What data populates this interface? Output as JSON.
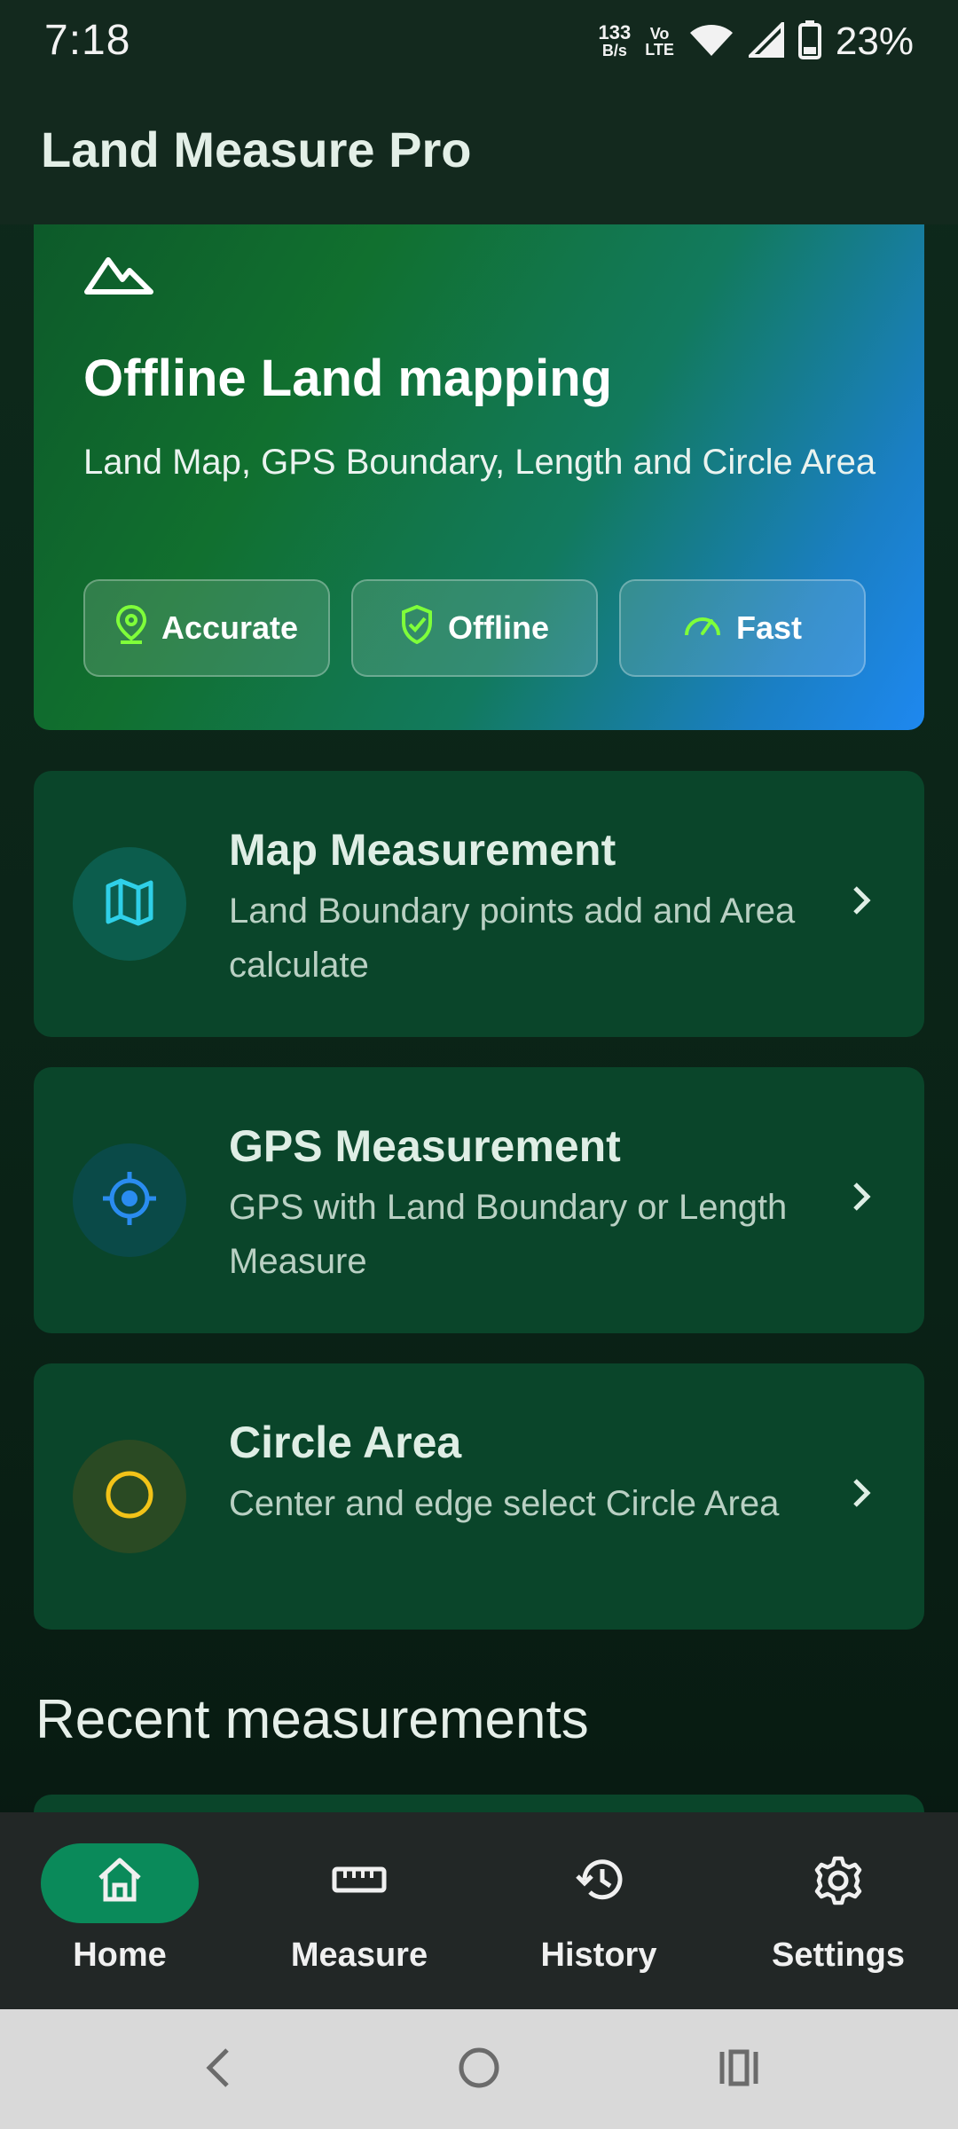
{
  "status_bar": {
    "time": "7:18",
    "net_speed_value": "133",
    "net_speed_unit": "B/s",
    "volte_top": "Vo",
    "volte_bottom": "LTE",
    "battery": "23%"
  },
  "app_bar": {
    "title": "Land Measure Pro"
  },
  "hero": {
    "title": "Offline Land mapping",
    "subtitle": "Land Map, GPS Boundary, Length and Circle Area",
    "chips": [
      {
        "label": "Accurate",
        "icon": "location-pin-icon"
      },
      {
        "label": "Offline",
        "icon": "shield-check-icon"
      },
      {
        "label": "Fast",
        "icon": "speedometer-icon"
      }
    ]
  },
  "features": [
    {
      "title": "Map Measurement",
      "description": "Land Boundary points add and Area calculate",
      "icon": "map-icon",
      "accent": "#2fd0e8"
    },
    {
      "title": "GPS Measurement",
      "description": "GPS with Land Boundary or Length Measure",
      "icon": "crosshair-icon",
      "accent": "#2a8cf0"
    },
    {
      "title": "Circle Area",
      "description": "Center and edge select Circle Area",
      "icon": "circle-icon",
      "accent": "#f2c318"
    }
  ],
  "recent": {
    "title": "Recent measurements"
  },
  "bottom_nav": [
    {
      "label": "Home",
      "icon": "home-icon",
      "active": true
    },
    {
      "label": "Measure",
      "icon": "ruler-icon",
      "active": false
    },
    {
      "label": "History",
      "icon": "history-icon",
      "active": false
    },
    {
      "label": "Settings",
      "icon": "gear-icon",
      "active": false
    }
  ],
  "colors": {
    "brand_green": "#0a8a5a",
    "card_bg": "#0a452a",
    "chip_icon_green": "#7fff3a"
  }
}
